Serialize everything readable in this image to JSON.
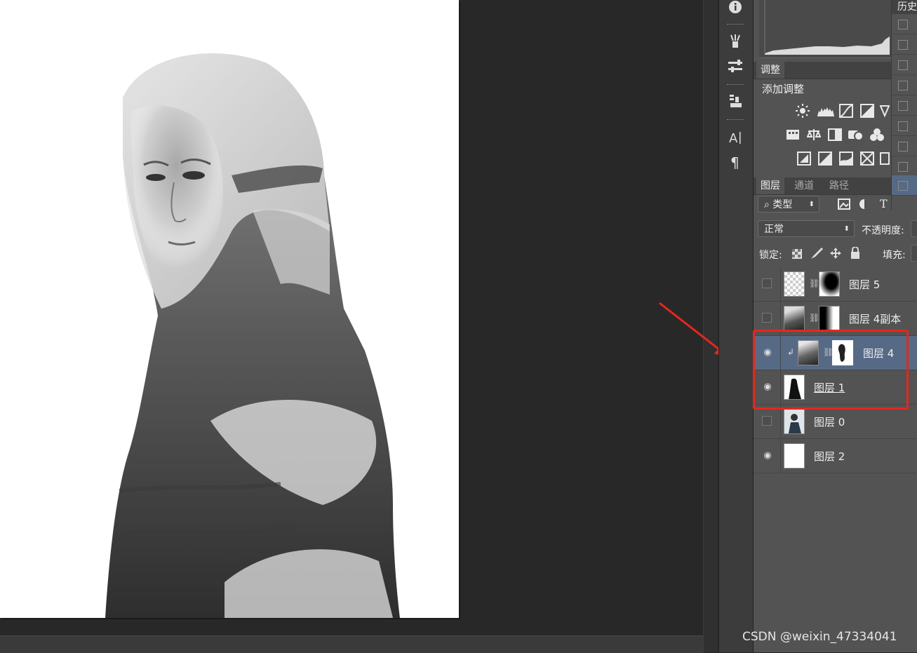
{
  "adjustments": {
    "tab_label": "调整",
    "title": "添加调整"
  },
  "panel_tabs": {
    "layers": "图层",
    "channels": "通道",
    "paths": "路径"
  },
  "history": {
    "tab_label": "历史"
  },
  "filter": {
    "label": "类型"
  },
  "blend": {
    "mode": "正常",
    "opacity_label": "不透明度:",
    "lock_label": "锁定:",
    "fill_label": "填充:"
  },
  "layers": [
    {
      "name": "图层 5",
      "visible": false,
      "selected": false,
      "has_mask": true
    },
    {
      "name": "图层 4副本",
      "visible": false,
      "selected": false,
      "has_mask": true
    },
    {
      "name": "图层 4",
      "visible": true,
      "selected": true,
      "has_mask": true,
      "clipped": true
    },
    {
      "name": "图层 1",
      "visible": true,
      "selected": false,
      "has_mask": false
    },
    {
      "name": "图层 0",
      "visible": false,
      "selected": false,
      "has_mask": false
    },
    {
      "name": "图层 2",
      "visible": true,
      "selected": false,
      "has_mask": false
    }
  ],
  "watermark": "CSDN @weixin_47334041",
  "colors": {
    "highlight": "#e8261c",
    "arrow": "#e8261c",
    "selected_row": "#566a86"
  }
}
